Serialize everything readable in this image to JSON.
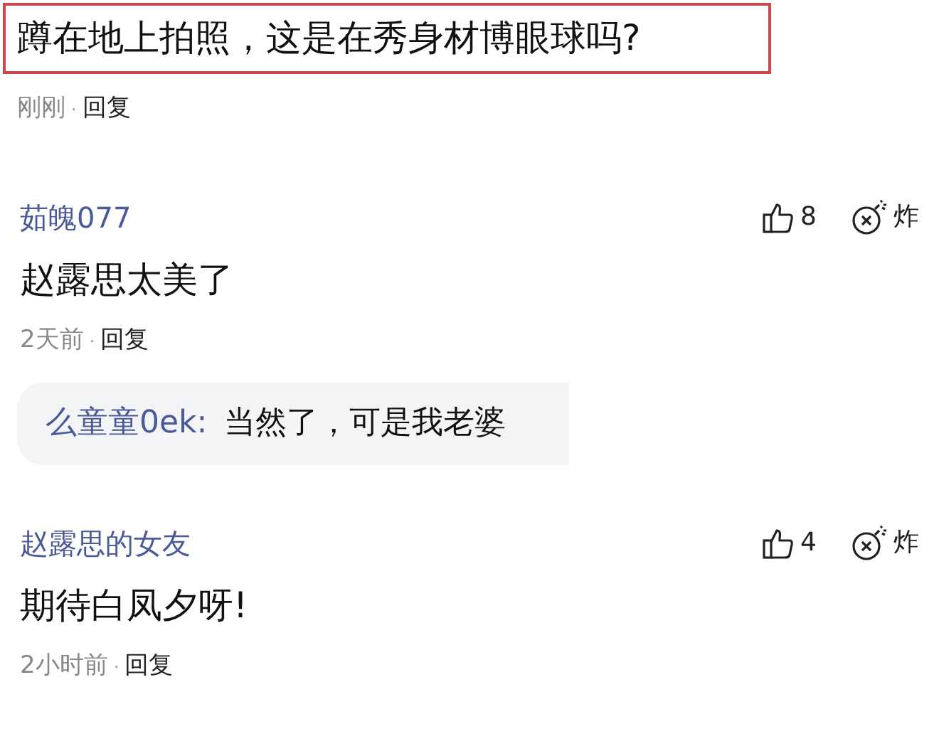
{
  "highlighted_comment": {
    "text": "蹲在地上拍照，这是在秀身材博眼球吗?",
    "time": "刚刚",
    "separator": "·",
    "reply": "回复"
  },
  "comments": [
    {
      "author": "茹魄077",
      "likes": "8",
      "bomb": "炸",
      "text": "赵露思太美了",
      "time": "2天前",
      "separator": "·",
      "reply": "回复",
      "replies": [
        {
          "author": "么童童0ek:",
          "text": "当然了，可是我老婆"
        }
      ]
    },
    {
      "author": "赵露思的女友",
      "likes": "4",
      "bomb": "炸",
      "text": "期待白凤夕呀!",
      "time": "2小时前",
      "separator": "·",
      "reply": "回复"
    }
  ]
}
